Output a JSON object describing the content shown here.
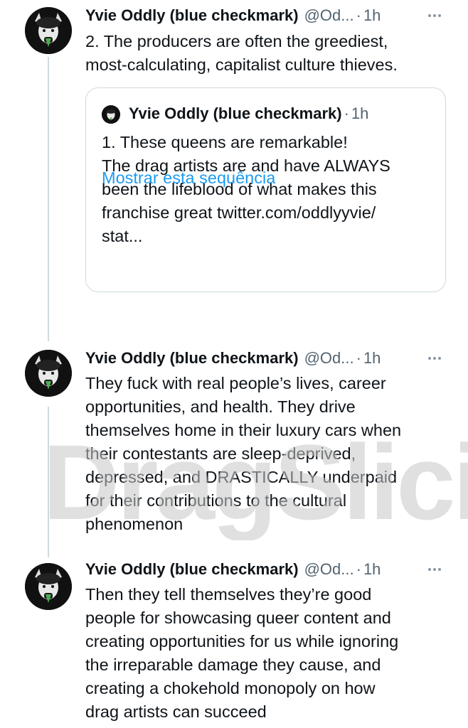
{
  "tweets": [
    {
      "name": "Yvie Oddly (blue checkmark)",
      "handle": "@Od...",
      "dot": "·",
      "time": "1h",
      "text": "2. The producers are often the greediest,\nmost-calculating,  capitalist culture thieves."
    },
    {
      "name": "Yvie Oddly (blue checkmark)",
      "handle": "@Od...",
      "dot": "·",
      "time": "1h",
      "text": "They fuck with real people’s lives, career\nopportunities, and health. They drive\nthemselves home in their luxury cars when\ntheir contestants are sleep-deprived,\ndepressed, and DRASTICALLY underpaid\nfor their contributions to the cultural\nphenomenon"
    },
    {
      "name": "Yvie Oddly (blue checkmark)",
      "handle": "@Od...",
      "dot": "·",
      "time": "1h",
      "text": "Then they tell themselves they’re good\npeople for showcasing queer content and\ncreating opportunities for us while ignoring\nthe irreparable damage they cause, and\ncreating a chokehold monopoly on how\ndrag artists can succeed"
    }
  ],
  "quote": {
    "name": "Yvie Oddly (blue checkmark)",
    "dot": "·",
    "time": "1h",
    "text": "1. These queens are remarkable!\nThe drag artists are and have ALWAYS\nbeen the lifeblood of what makes this\nfranchise great twitter.com/oddlyyvie/\nstat...",
    "show_thread": "Mostrar esta sequência"
  },
  "watermark": "DragSlicious",
  "colors": {
    "text": "#0f1419",
    "secondary": "#536471",
    "link": "#1d9bf0",
    "border": "#cfd9de"
  },
  "icons": [
    "avatar",
    "more-icon"
  ]
}
